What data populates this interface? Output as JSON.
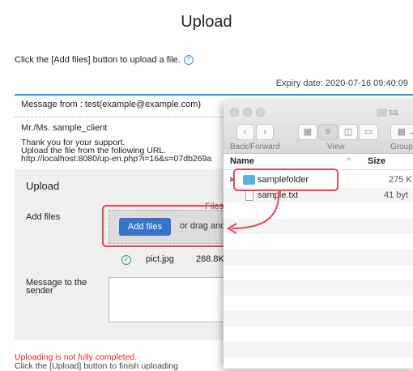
{
  "page": {
    "title": "Upload",
    "intro": "Click the [Add files] button to upload a file.",
    "help_icon": "?",
    "expiry": "Expiry date: 2020-07-16 09:40:09",
    "message_from": "Message from : test(example@example.com)",
    "recipient": "Mr./Ms. sample_client",
    "body": "Thank you for your support.\nUpload the file from the following URL.\nhttp://localhost:8080/up-en.php?i=16&s=07db269a"
  },
  "upload": {
    "heading": "Upload",
    "files_label": "Files",
    "add_files_label": "Add files",
    "add_files_button": "Add files",
    "drag_text": "or drag and",
    "file": {
      "name": "pict.jpg",
      "size": "268.8KB",
      "status_icon": "check-circle-icon"
    },
    "message_label": "Message to the sender",
    "textarea_value": ""
  },
  "status": {
    "warning": "Uploading is not fully completed.",
    "instruction": "Click the [Upload] button to finish uploading"
  },
  "finder": {
    "window_title": "sa",
    "toolbar_labels": {
      "nav": "Back/Forward",
      "view": "View",
      "group": "Group"
    },
    "columns": {
      "name": "Name",
      "size": "Size"
    },
    "items": [
      {
        "name": "samplefolder",
        "size": "275 K",
        "type": "folder"
      },
      {
        "name": "sample.txt",
        "size": "41 byt",
        "type": "file"
      }
    ]
  },
  "colors": {
    "accent": "#3573c8",
    "rule": "#3a8ee6",
    "highlight": "#e8465a",
    "warning": "#d62b2b",
    "folder": "#57b3e8"
  }
}
